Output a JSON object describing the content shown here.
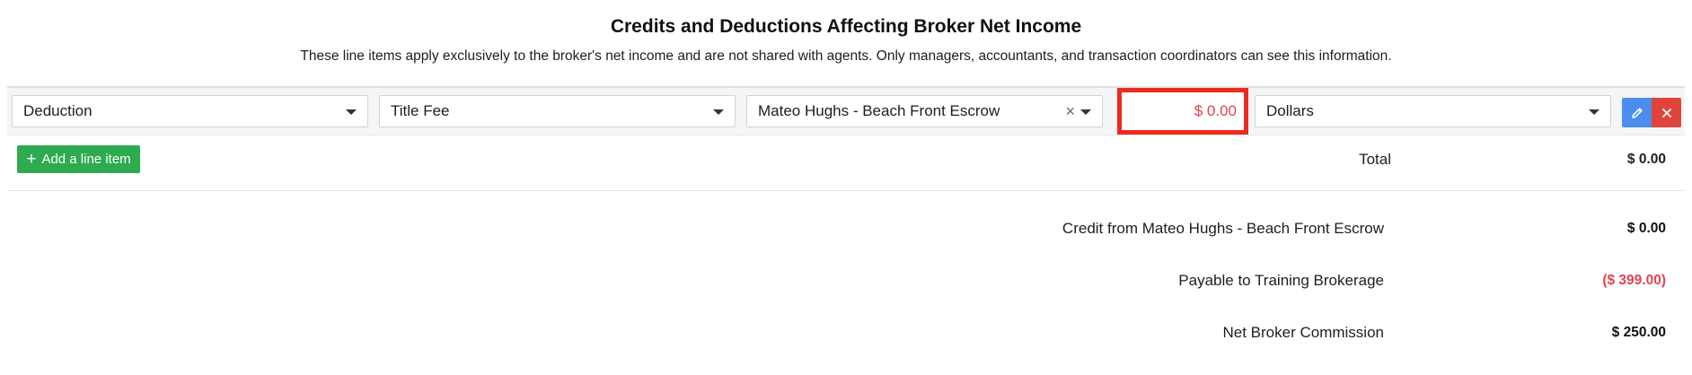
{
  "header": {
    "title": "Credits and Deductions Affecting Broker Net Income",
    "subtitle": "These line items apply exclusively to the broker's net income and are not shared with agents. Only managers, accountants, and transaction coordinators can see this information."
  },
  "line_item": {
    "type": "Deduction",
    "category": "Title Fee",
    "party": "Mateo Hughs - Beach Front Escrow",
    "clear_symbol": "×",
    "amount": "$ 0.00",
    "unit": "Dollars"
  },
  "actions": {
    "add_label": "Add a line item",
    "add_symbol": "+"
  },
  "totals": {
    "total_label": "Total",
    "total_value": "$ 0.00"
  },
  "summary": [
    {
      "label": "Credit from Mateo Hughs - Beach Front Escrow",
      "value": "$ 0.00"
    },
    {
      "label": "Payable to Training Brokerage",
      "value": "($ 399.00)"
    },
    {
      "label": "Net Broker Commission",
      "value": "$ 250.00"
    }
  ],
  "colors": {
    "highlight_border": "#ee2a1f",
    "negative_text": "#e4424f",
    "edit_button": "#4c8ef0",
    "delete_button": "#e0443a",
    "add_button": "#2eaa4f"
  },
  "icons": {
    "edit": "pencil-icon",
    "delete": "close-icon",
    "dropdown": "chevron-down-icon"
  }
}
